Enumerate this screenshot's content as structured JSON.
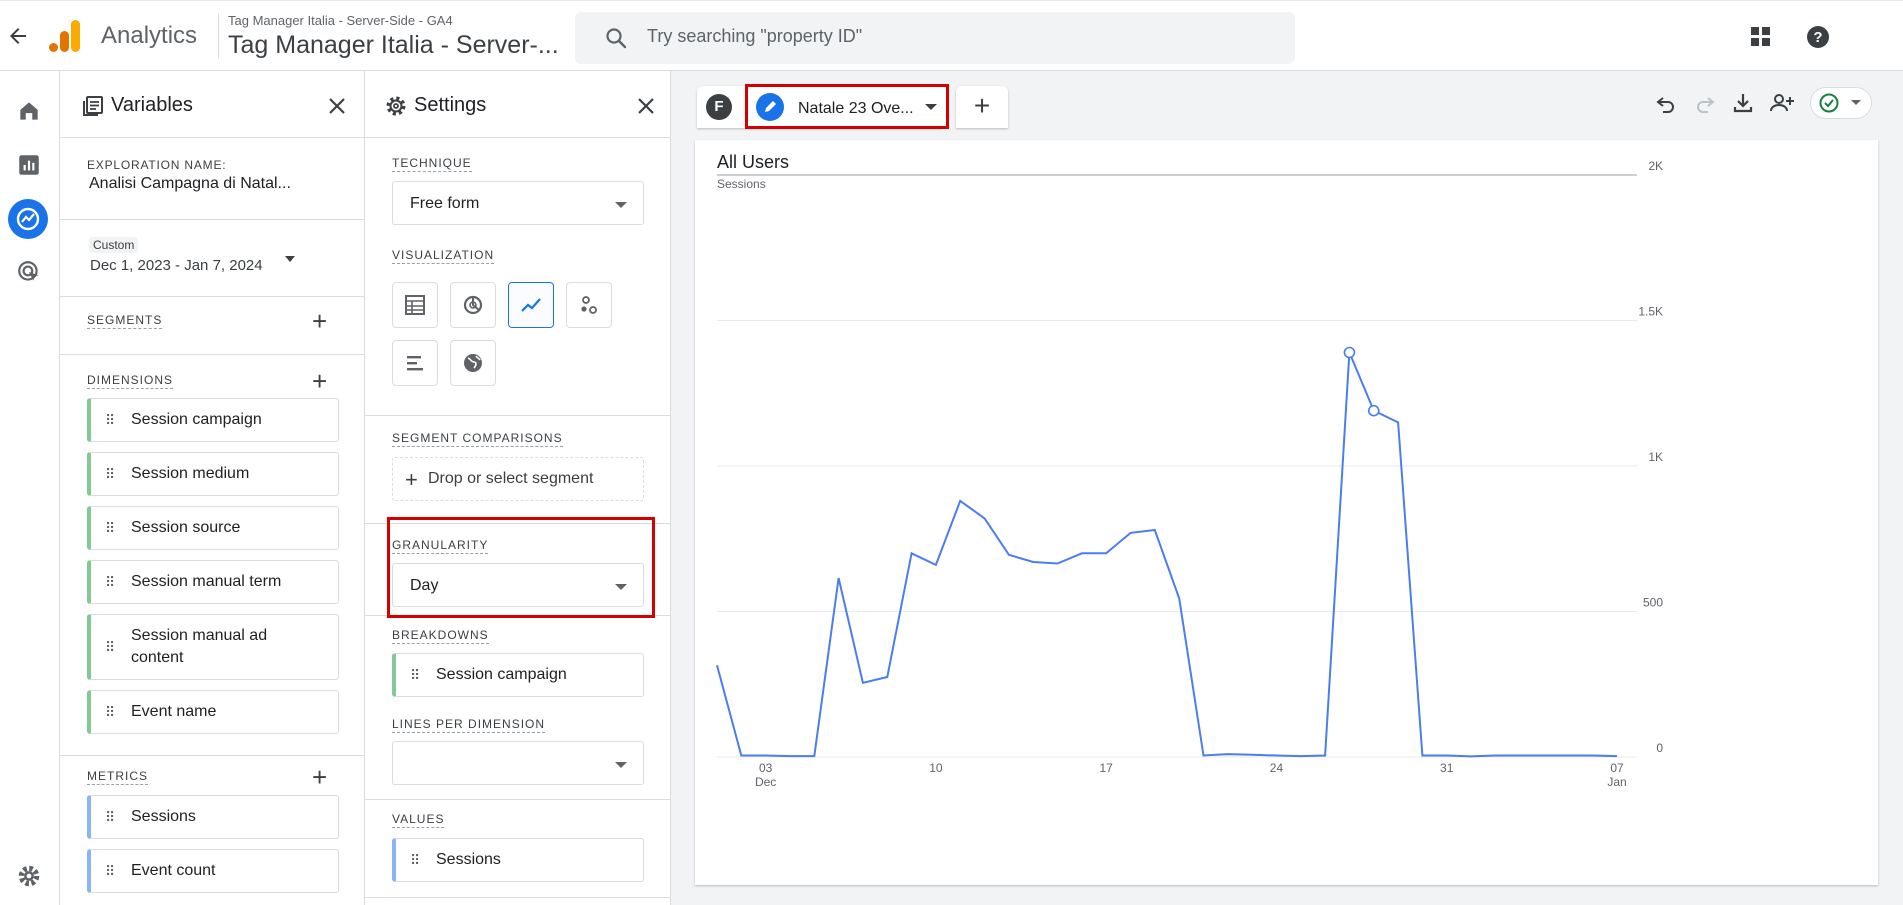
{
  "app": {
    "name": "Analytics",
    "account_small": "Tag Manager Italia - Server-Side - GA4",
    "account_big": "Tag Manager Italia - Server-...",
    "search_placeholder": "Try searching \"property ID\""
  },
  "variables_panel": {
    "title": "Variables",
    "exploration_name_label": "EXPLORATION NAME:",
    "exploration_name": "Analisi Campagna di Natal...",
    "date_badge": "Custom",
    "date_range": "Dec 1, 2023 - Jan 7, 2024",
    "segments_label": "SEGMENTS",
    "dimensions_label": "DIMENSIONS",
    "dimensions": [
      "Session campaign",
      "Session medium",
      "Session source",
      "Session manual term",
      "Session manual ad content",
      "Event name"
    ],
    "metrics_label": "METRICS",
    "metrics": [
      "Sessions",
      "Event count"
    ]
  },
  "settings_panel": {
    "title": "Settings",
    "technique_label": "TECHNIQUE",
    "technique_value": "Free form",
    "visualization_label": "VISUALIZATION",
    "visualizations": [
      "table-icon",
      "donut-chart-icon",
      "line-chart-icon",
      "scatter-icon",
      "bar-chart-icon",
      "geo-map-icon"
    ],
    "selected_visualization": "line-chart-icon",
    "segment_comparisons_label": "SEGMENT COMPARISONS",
    "drop_segment": "Drop or select segment",
    "granularity_label": "GRANULARITY",
    "granularity_value": "Day",
    "breakdowns_label": "BREAKDOWNS",
    "breakdown": "Session campaign",
    "lines_per_dimension_label": "LINES PER DIMENSION",
    "lines_per_dimension_value": "",
    "values_label": "VALUES",
    "value": "Sessions"
  },
  "tabs": {
    "avatar_letter": "F",
    "active_tab": "Natale 23 Ove..."
  },
  "colors": {
    "accent": "#1a73e8",
    "line": "#4a7ef0",
    "highlight": "#d50000",
    "dimension": "#81c995",
    "metric": "#8ab4f8"
  },
  "chart_data": {
    "type": "line",
    "title": "All Users",
    "ylabel": "Sessions",
    "ylim": [
      0,
      2000
    ],
    "yticks": [
      "0",
      "500",
      "1K",
      "1.5K",
      "2K"
    ],
    "xticks": [
      {
        "day": "03",
        "month": "Dec"
      },
      {
        "day": "10",
        "month": ""
      },
      {
        "day": "17",
        "month": ""
      },
      {
        "day": "24",
        "month": ""
      },
      {
        "day": "31",
        "month": ""
      },
      {
        "day": "07",
        "month": "Jan"
      }
    ],
    "series": [
      {
        "x": [
          "2023-12-01",
          "2023-12-02",
          "2023-12-03",
          "2023-12-04",
          "2023-12-05",
          "2023-12-06",
          "2023-12-07",
          "2023-12-08",
          "2023-12-09",
          "2023-12-10",
          "2023-12-11",
          "2023-12-12",
          "2023-12-13",
          "2023-12-14",
          "2023-12-15",
          "2023-12-16",
          "2023-12-17",
          "2023-12-18",
          "2023-12-19",
          "2023-12-20",
          "2023-12-21",
          "2023-12-22",
          "2023-12-23",
          "2023-12-24",
          "2023-12-25",
          "2023-12-26",
          "2023-12-27",
          "2023-12-28",
          "2023-12-29",
          "2023-12-30",
          "2023-12-31",
          "2024-01-01",
          "2024-01-02",
          "2024-01-03",
          "2024-01-04",
          "2024-01-05",
          "2024-01-06",
          "2024-01-07"
        ],
        "values": [
          315,
          5,
          5,
          3,
          3,
          615,
          255,
          275,
          700,
          660,
          880,
          820,
          695,
          670,
          665,
          700,
          700,
          770,
          780,
          545,
          5,
          10,
          8,
          5,
          3,
          5,
          1390,
          1190,
          1150,
          5,
          5,
          2,
          5,
          5,
          5,
          5,
          5,
          3
        ],
        "highlighted_points": [
          26,
          27
        ]
      }
    ]
  }
}
